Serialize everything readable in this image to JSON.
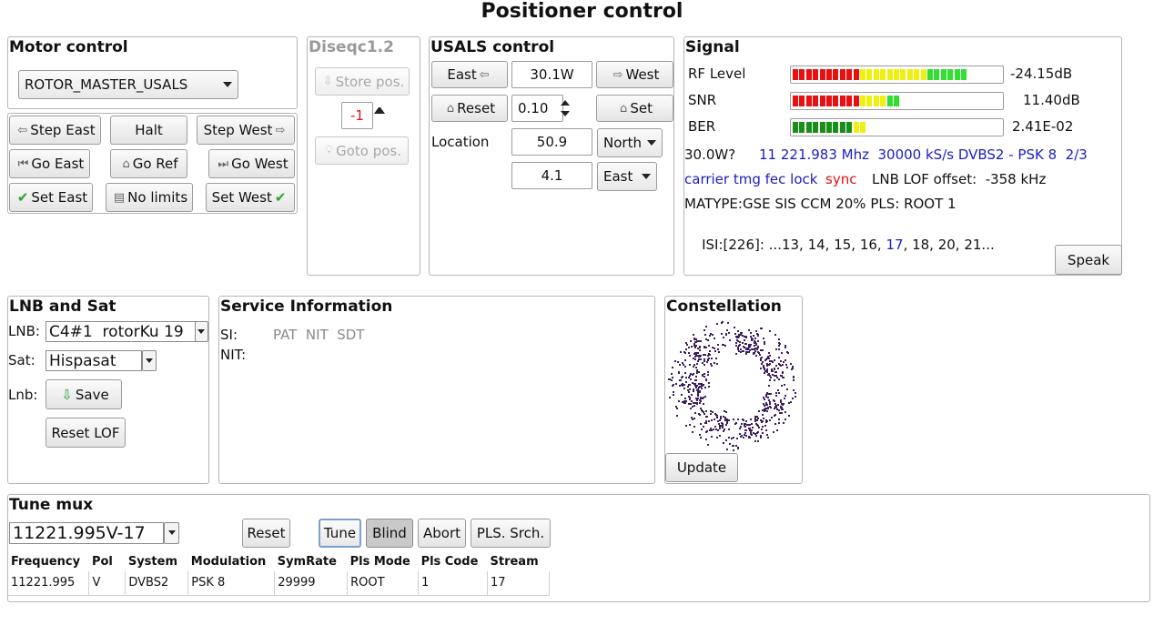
{
  "page_title": "Positioner control",
  "motor": {
    "title": "Motor control",
    "rotor_select": "ROTOR_MASTER_USALS",
    "step_east": "Step East",
    "halt": "Halt",
    "step_west": "Step West",
    "go_east": "Go East",
    "go_ref": "Go Ref",
    "go_west": "Go West",
    "set_east": "Set East",
    "no_limits": "No limits",
    "set_west": "Set West"
  },
  "diseqc": {
    "title": "Diseqc1.2",
    "store_pos": "Store pos.",
    "position_value": "-1",
    "goto_pos": "Goto pos."
  },
  "usals": {
    "title": "USALS control",
    "east": "East",
    "position": "30.1W",
    "west": "West",
    "reset": "Reset",
    "step": "0.10",
    "set": "Set",
    "location_label": "Location",
    "latitude": "50.9",
    "lat_dir": "North",
    "longitude": "4.1",
    "lon_dir": "East"
  },
  "signal": {
    "title": "Signal",
    "rows": [
      {
        "label": "RF Level",
        "value": "-24.15dB",
        "fill": 0.87,
        "scheme": "rf"
      },
      {
        "label": "SNR",
        "value": "11.40dB",
        "fill": 0.54,
        "scheme": "snr"
      },
      {
        "label": "BER",
        "value": "2.41E-02",
        "fill": 0.38,
        "scheme": "ber"
      }
    ],
    "sat_pos": "30.0W?",
    "freq_info": "11 221.983 Mhz  30000 kS/s DVBS2 - PSK 8  2/3",
    "lock_flags": "carrier tmg fec lock",
    "sync_flag": "sync",
    "lof_offset": "LNB LOF offset:  -358 kHz",
    "matype": "MATYPE:GSE SIS CCM 20% PLS: ROOT 1",
    "isi_prefix": "ISI:[226]: ...13, 14, 15, 16, ",
    "isi_active": "17",
    "isi_suffix": ", 18, 20, 21...",
    "speak": "Speak"
  },
  "lnb": {
    "title": "LNB and Sat",
    "lnb_label": "LNB:",
    "lnb_value": "C4#1  rotorKu 19",
    "sat_label": "Sat:",
    "sat_value": "Hispasat",
    "lnb_btn_label": "Lnb:",
    "save": "Save",
    "reset_lof": "Reset LOF"
  },
  "service": {
    "title": "Service Information",
    "si_label": "SI:",
    "si_tables": "PAT  NIT  SDT",
    "nit_label": "NIT:"
  },
  "constellation": {
    "title": "Constellation",
    "update": "Update",
    "point_color": "#3b1f5c"
  },
  "tune": {
    "title": "Tune mux",
    "mux_value": "11221.995V-17",
    "reset": "Reset",
    "tune": "Tune",
    "blind": "Blind",
    "abort": "Abort",
    "pls_search": "PLS. Srch.",
    "columns": [
      "Frequency",
      "Pol",
      "System",
      "Modulation",
      "SymRate",
      "Pls Mode",
      "Pls Code",
      "Stream"
    ],
    "row": [
      "11221.995",
      "V",
      "DVBS2",
      "PSK 8",
      "29999",
      "ROOT",
      "1",
      "17"
    ]
  }
}
